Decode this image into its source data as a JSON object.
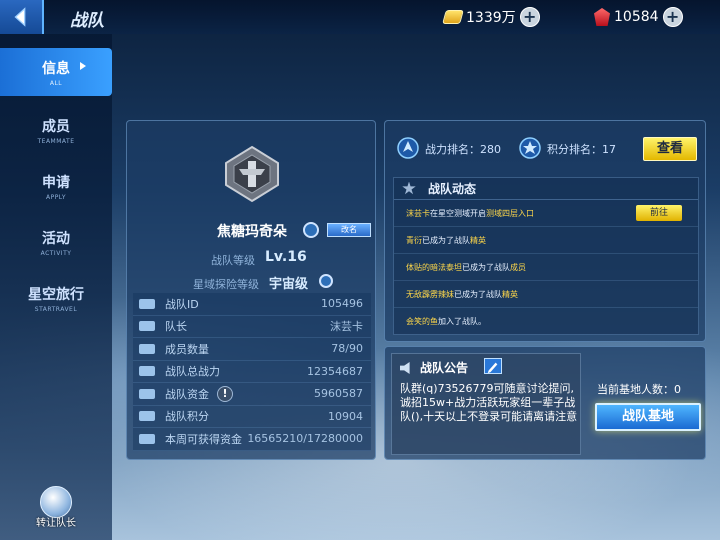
{
  "header": {
    "title": "战队",
    "currency1": {
      "icon": "gold-coin-icon",
      "value": "1339万"
    },
    "currency2": {
      "icon": "red-gem-icon",
      "value": "10584"
    }
  },
  "nav": [
    {
      "cn": "信息",
      "en": "ALL",
      "active": true
    },
    {
      "cn": "成员",
      "en": "TEAMMATE",
      "active": false
    },
    {
      "cn": "申请",
      "en": "APPLY",
      "active": false
    },
    {
      "cn": "活动",
      "en": "ACTIVITY",
      "active": false
    },
    {
      "cn": "星空旅行",
      "en": "STARTRAVEL",
      "active": false
    }
  ],
  "transfer_label": "转让队长",
  "team": {
    "name": "焦糖玛奇朵",
    "rename_label": "改名",
    "level_label": "战队等级",
    "level": "Lv.16",
    "rank_label": "星域探险等级",
    "rank_value": "宇宙级"
  },
  "stats": [
    {
      "key": "战队ID",
      "value": "105496"
    },
    {
      "key": "队长",
      "value": "沫芸卡"
    },
    {
      "key": "成员数量",
      "value": "78/90"
    },
    {
      "key": "战队总战力",
      "value": "12354687"
    },
    {
      "key": "战队资金",
      "value": "5960587"
    },
    {
      "key": "战队积分",
      "value": "10904"
    },
    {
      "key": "本周可获得资金",
      "value": "16565210/17280000"
    }
  ],
  "ranking": {
    "power_label": "战力排名：280",
    "score_label": "积分排名：17",
    "view_label": "查看"
  },
  "news": {
    "title": "战队动态",
    "goto_label": "前往",
    "items": [
      {
        "a": "沫芸卡",
        "b": "在星空测域开启",
        "c": "测域四层入口",
        "d": ""
      },
      {
        "a": "青衍",
        "b": "已成为了战队",
        "c": "精英",
        "d": ""
      },
      {
        "a": "体贴的暗法泰坦",
        "b": "已成为了战队",
        "c": "成员",
        "d": ""
      },
      {
        "a": "无敌霹雳辣妹",
        "b": "已成为了战队",
        "c": "精英",
        "d": ""
      },
      {
        "a": "会笑的鱼",
        "b": "加入了战队。",
        "c": "",
        "d": ""
      }
    ]
  },
  "announcement": {
    "title": "战队公告",
    "text": "队群(q)73526779可随意讨论提问,诚招15w+战力活跃玩家组一辈子战队(),十天以上不登录可能请离请注意"
  },
  "base": {
    "count_label": "当前基地人数：0",
    "button_label": "战队基地"
  }
}
